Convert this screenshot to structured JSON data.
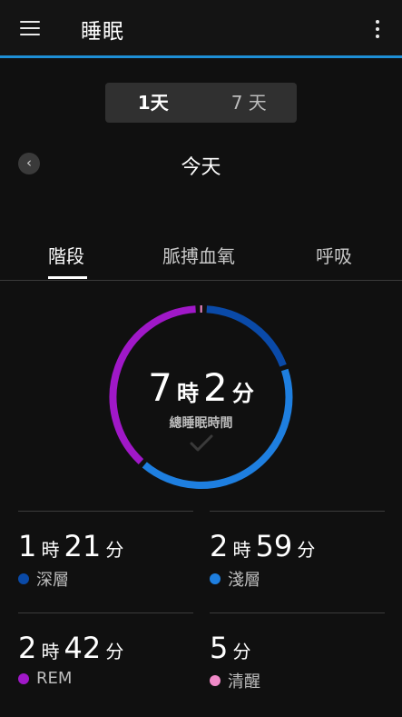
{
  "appbar": {
    "title": "睡眠",
    "menu_icon": "hamburger-menu-icon",
    "more_icon": "more-vert-icon"
  },
  "range": {
    "options": [
      "1天",
      "7 天"
    ],
    "selected": "1天"
  },
  "date_nav": {
    "back_icon": "chevron-left-icon",
    "label": "今天"
  },
  "tabs": [
    {
      "label": "階段",
      "active": true
    },
    {
      "label": "脈搏血氧",
      "active": false
    },
    {
      "label": "呼吸",
      "active": false
    }
  ],
  "total": {
    "hours": "7",
    "hours_unit": "時",
    "minutes": "2",
    "minutes_unit": "分",
    "label": "總睡眠時間"
  },
  "colors": {
    "deep": "#0a4aa8",
    "light": "#1e7fe0",
    "rem": "#a018c8",
    "awake": "#f08ac8",
    "accent": "#1e8fd6"
  },
  "stats": [
    {
      "hours": "1",
      "h_unit": "時",
      "minutes": "21",
      "m_unit": "分",
      "label": "深層",
      "color": "#0a4aa8"
    },
    {
      "hours": "2",
      "h_unit": "時",
      "minutes": "59",
      "m_unit": "分",
      "label": "淺層",
      "color": "#1e7fe0"
    },
    {
      "hours": "2",
      "h_unit": "時",
      "minutes": "42",
      "m_unit": "分",
      "label": "REM",
      "color": "#a018c8"
    },
    {
      "hours": "",
      "h_unit": "",
      "minutes": "5",
      "m_unit": "分",
      "label": "清醒",
      "color": "#f08ac8"
    }
  ],
  "ring_minutes": {
    "deep": 81,
    "light": 179,
    "rem": 162,
    "awake": 5
  }
}
